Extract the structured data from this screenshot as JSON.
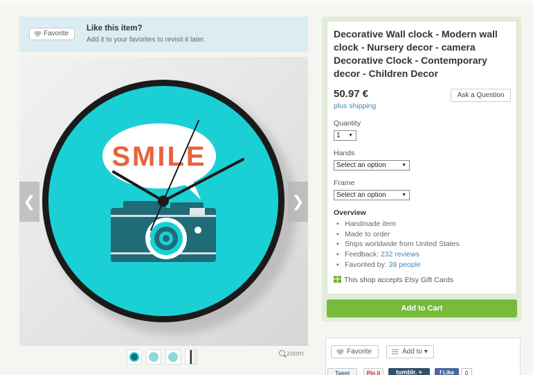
{
  "like_bar": {
    "favorite_label": "Favorite",
    "title": "Like this item?",
    "subtitle": "Add it to your favorites to revisit it later."
  },
  "photo": {
    "sign_text": "SMILE",
    "colors": {
      "face": "#1ad0d4",
      "rim": "#1a1a1a",
      "camera": "#1f6b78",
      "sign_text": "#e8623c"
    }
  },
  "gallery": {
    "prev_glyph": "❮",
    "next_glyph": "❯",
    "zoom_label": "zoom",
    "thumb_count": 4
  },
  "listing": {
    "title": "Decorative Wall clock - Modern wall clock - Nursery decor - camera Decorative Clock - Contemporary decor - Children Decor",
    "price": "50.97 €",
    "shipping": "plus shipping",
    "ask_label": "Ask a Question",
    "quantity_label": "Quantity",
    "quantity_value": "1",
    "hands_label": "Hands",
    "hands_value": "Select an option",
    "frame_label": "Frame",
    "frame_value": "Select an option",
    "overview_title": "Overview",
    "overview": {
      "handmade": "Handmade item",
      "made_to_order": "Made to order",
      "ships": "Ships worldwide from United States",
      "feedback_prefix": "Feedback:",
      "feedback_link": "232 reviews",
      "favorited_prefix": "Favorited by:",
      "favorited_link": "39 people"
    },
    "gift_text": "This shop accepts Etsy Gift Cards",
    "add_to_cart": "Add to Cart",
    "accent_color": "#77ba3c"
  },
  "actions": {
    "favorite_label": "Favorite",
    "add_to_label": "Add to ▾",
    "tweet": "Tweet",
    "pinit": "Pin it",
    "tumblr": "tumblr. +",
    "like": "f Like",
    "like_count": "0"
  }
}
